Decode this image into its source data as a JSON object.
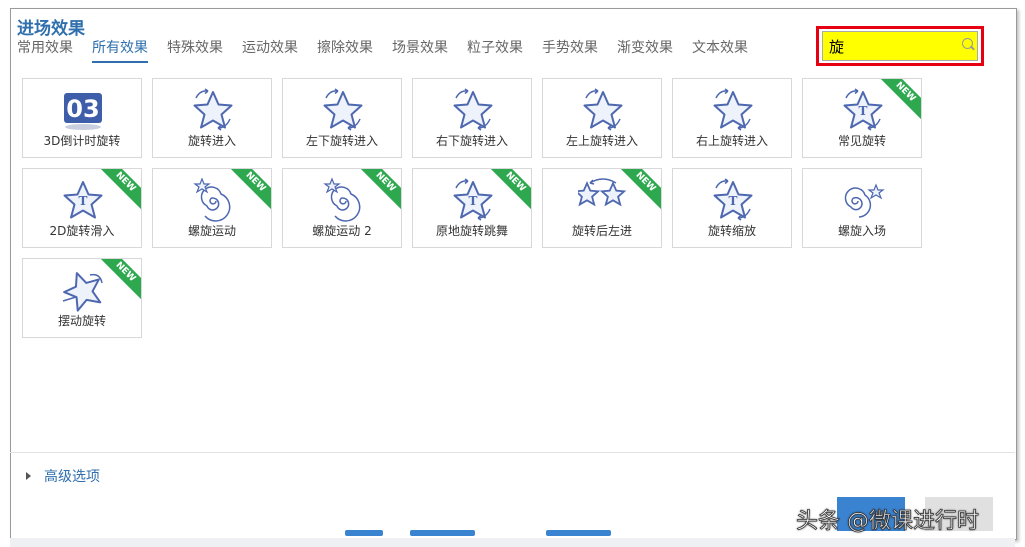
{
  "dialog": {
    "title": "进场效果"
  },
  "tabs": [
    {
      "label": "常用效果"
    },
    {
      "label": "所有效果"
    },
    {
      "label": "特殊效果"
    },
    {
      "label": "运动效果"
    },
    {
      "label": "擦除效果"
    },
    {
      "label": "场景效果"
    },
    {
      "label": "粒子效果"
    },
    {
      "label": "手势效果"
    },
    {
      "label": "渐变效果"
    },
    {
      "label": "文本效果"
    }
  ],
  "active_tab": "所有效果",
  "search": {
    "value": "旋"
  },
  "tiles": [
    {
      "label": "3D倒计时旋转",
      "icon": "countdown-03-icon",
      "new": false
    },
    {
      "label": "旋转进入",
      "icon": "star-rotate-icon",
      "new": false
    },
    {
      "label": "左下旋转进入",
      "icon": "star-rotate-icon",
      "new": false
    },
    {
      "label": "右下旋转进入",
      "icon": "star-rotate-icon",
      "new": false
    },
    {
      "label": "左上旋转进入",
      "icon": "star-rotate-icon",
      "new": false
    },
    {
      "label": "右上旋转进入",
      "icon": "star-rotate-icon",
      "new": false
    },
    {
      "label": "常见旋转",
      "icon": "star-letter-rotate-icon",
      "new": true
    },
    {
      "label": "2D旋转滑入",
      "icon": "star-letter-icon",
      "new": true
    },
    {
      "label": "螺旋运动",
      "icon": "spiral-icon",
      "new": true
    },
    {
      "label": "螺旋运动 2",
      "icon": "spiral-icon",
      "new": true
    },
    {
      "label": "原地旋转跳舞",
      "icon": "star-letter-rotate-icon",
      "new": true
    },
    {
      "label": "旋转后左进",
      "icon": "double-star-icon",
      "new": true
    },
    {
      "label": "旋转缩放",
      "icon": "star-letter-rotate-icon",
      "new": false
    },
    {
      "label": "螺旋入场",
      "icon": "spiral-star-icon",
      "new": false
    },
    {
      "label": "摆动旋转",
      "icon": "tilted-star-icon",
      "new": true
    }
  ],
  "new_badge": "NEW",
  "advanced": {
    "label": "高级选项"
  },
  "watermark": "头条 @微课进行时",
  "colors": {
    "accent": "#2f6fad",
    "search_bg": "#ffff00",
    "highlight": "#e60012",
    "badge": "#2ea84f",
    "icon": "#4e68b0"
  }
}
